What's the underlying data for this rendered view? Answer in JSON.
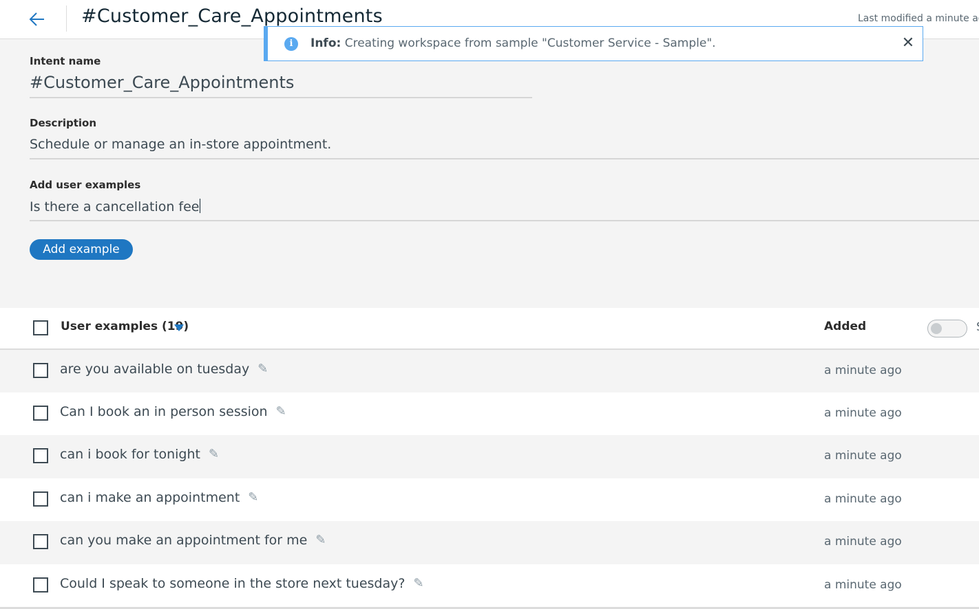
{
  "header": {
    "title": "#Customer_Care_Appointments",
    "last_modified": "Last modified a minute ago"
  },
  "toast": {
    "label": "Info:",
    "message": " Creating workspace from sample \"Customer Service - Sample\".",
    "icon": "info-icon",
    "close_icon": "close-icon"
  },
  "form": {
    "intent_label": "Intent name",
    "intent_value": "#Customer_Care_Appointments",
    "description_label": "Description",
    "description_value": "Schedule or manage an in-store appointment.",
    "examples_label": "Add user examples",
    "examples_value": "Is there a cancellation fee",
    "add_button": "Add example"
  },
  "table": {
    "header_label": "User examples (19)",
    "added_label": "Added",
    "toggle_tail": "S",
    "rows": [
      {
        "text": "are you available on tuesday",
        "added": "a minute ago"
      },
      {
        "text": "Can I book an in person session",
        "added": "a minute ago"
      },
      {
        "text": "can i book for tonight",
        "added": "a minute ago"
      },
      {
        "text": "can i make an appointment",
        "added": "a minute ago"
      },
      {
        "text": "can you make an appointment for me",
        "added": "a minute ago"
      },
      {
        "text": "Could I speak to someone in the store next tuesday?",
        "added": "a minute ago"
      }
    ]
  },
  "colors": {
    "accent": "#1f77c2",
    "info": "#5aa9f0"
  }
}
